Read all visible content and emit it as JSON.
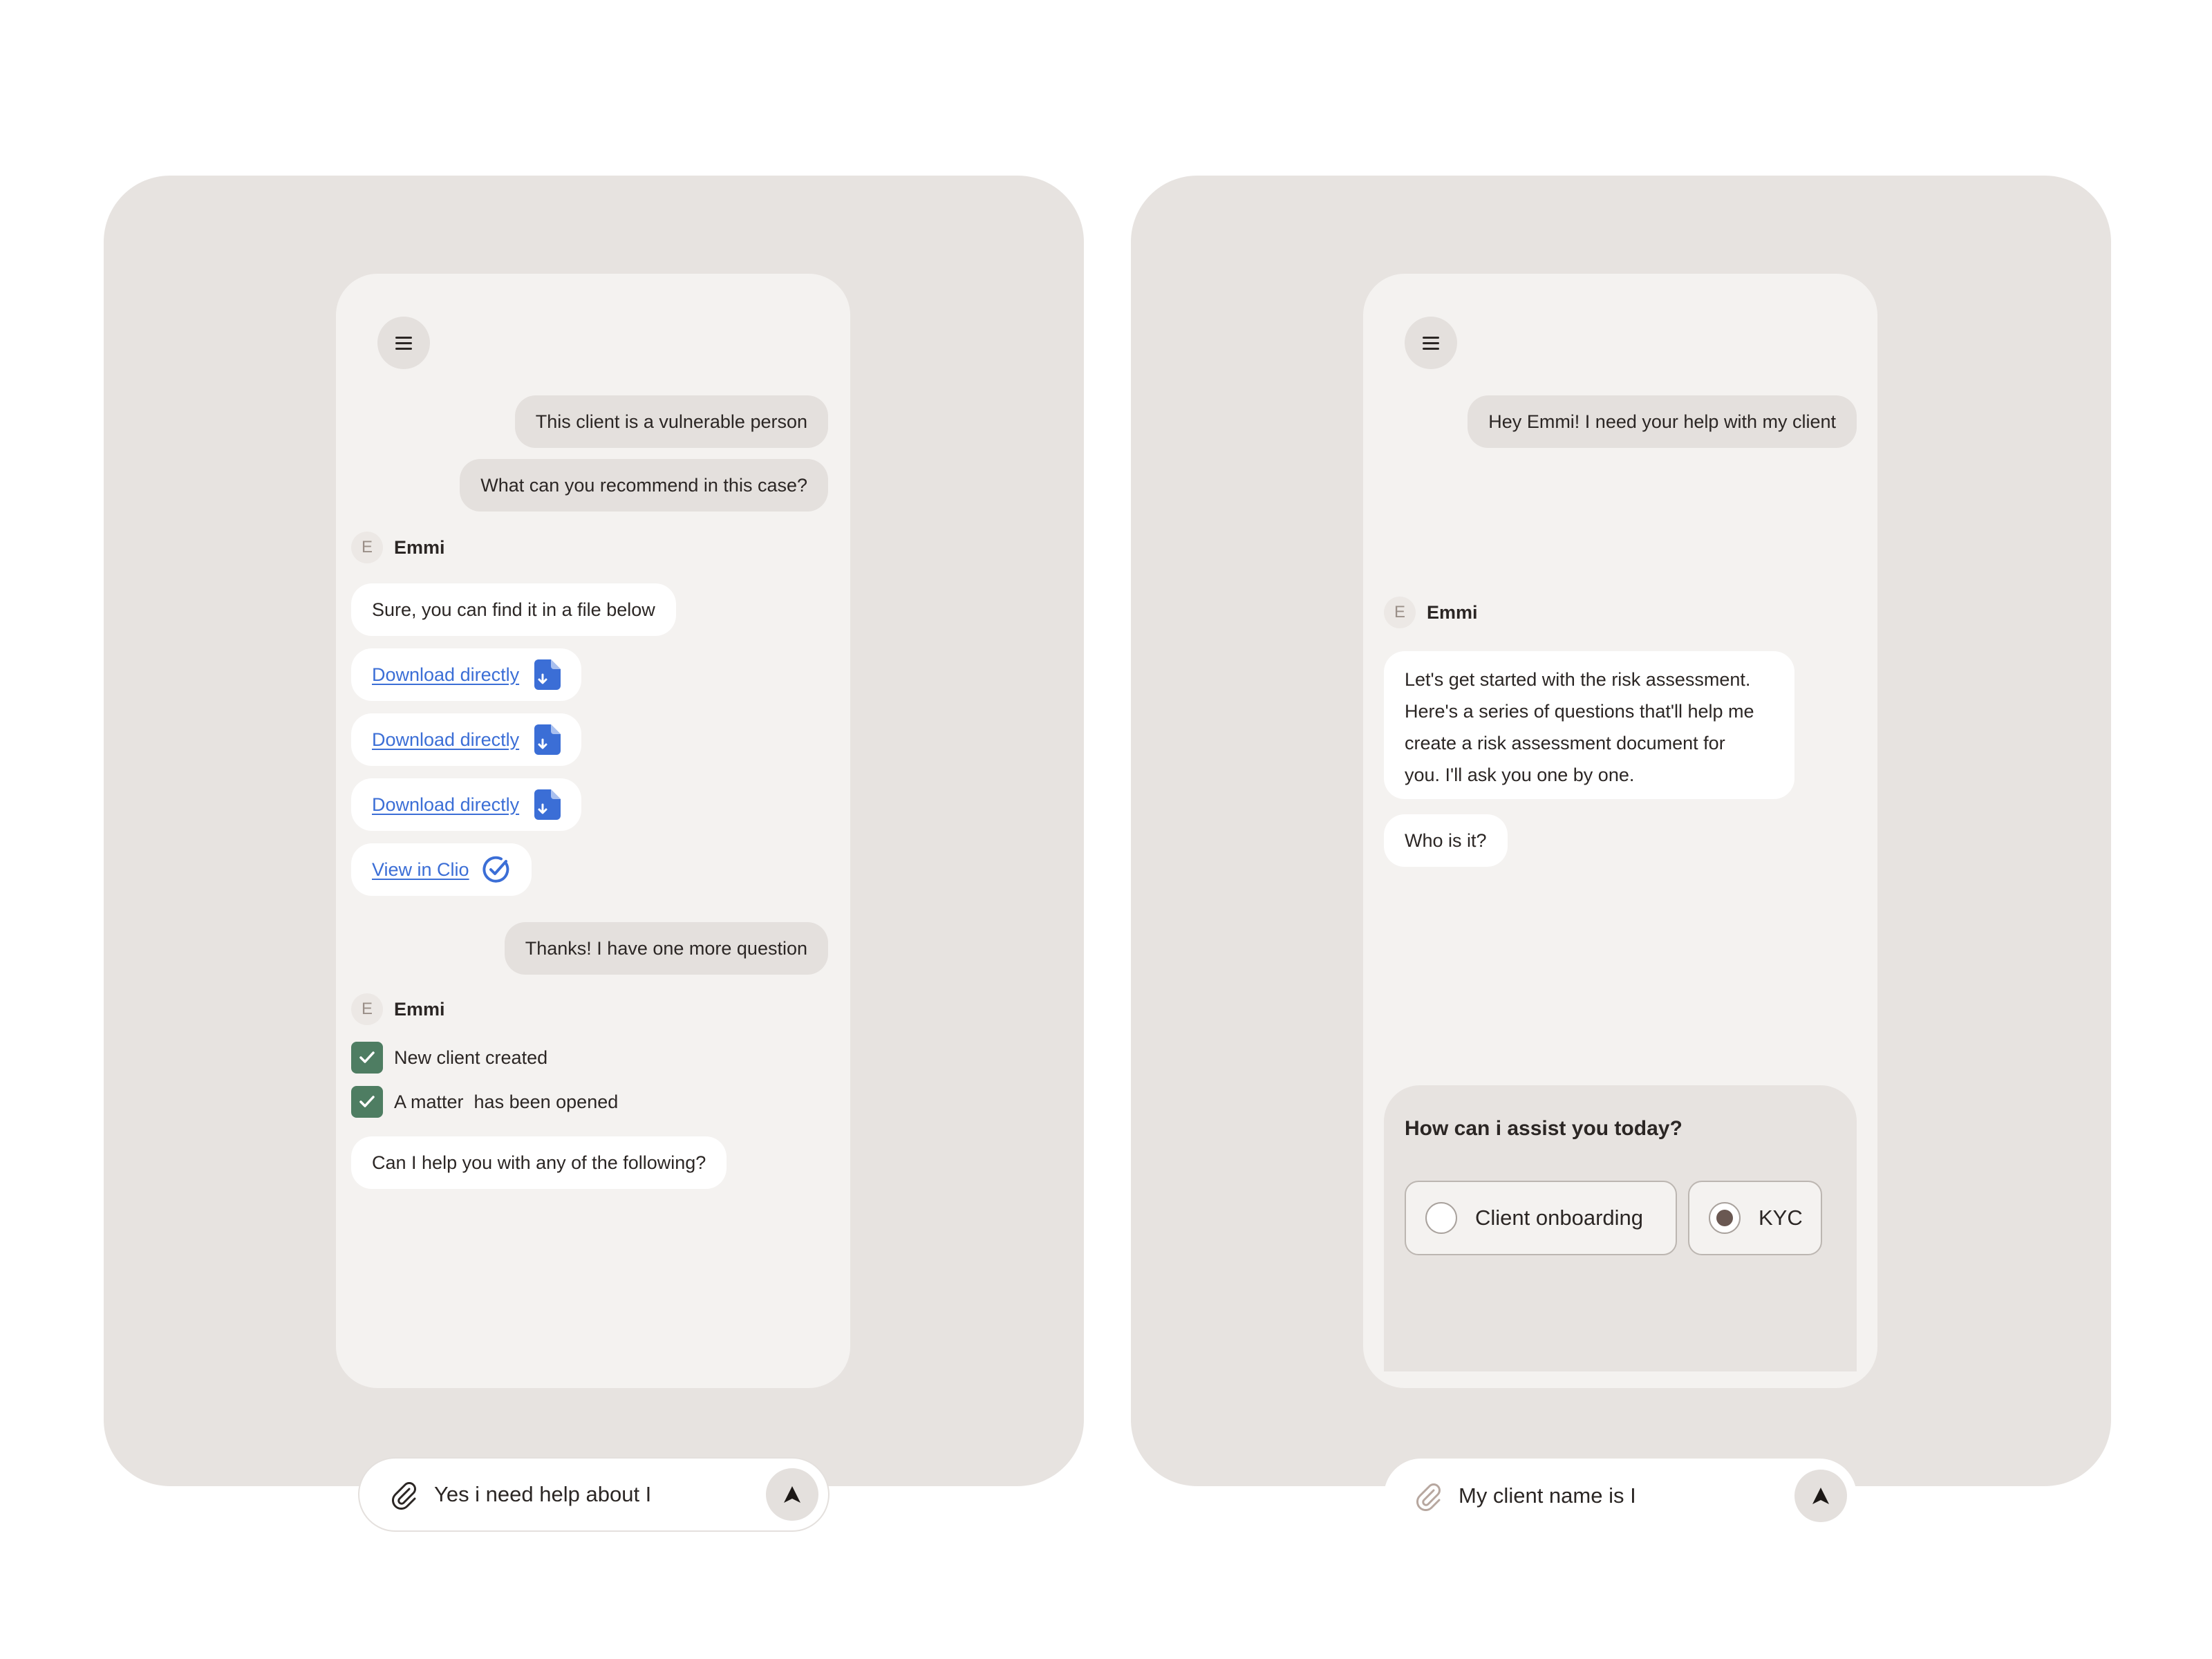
{
  "left_chat": {
    "user_messages": [
      "This client is a vulnerable person",
      "What can you recommend in this case?",
      "Thanks! I have one more question"
    ],
    "sender_name": "Emmi",
    "sender_initial": "E",
    "bot_reply": "Sure, you can find it in a file below",
    "downloads": [
      "Download directly",
      "Download directly",
      "Download directly"
    ],
    "view_link": "View in Clio",
    "checklist": [
      "New client created",
      "A matter  has been opened"
    ],
    "followup": "Can I help you with any of the following?",
    "input_value": "Yes i need help about I"
  },
  "right_chat": {
    "user_message": "Hey Emmi! I need your help with my client",
    "sender_name": "Emmi",
    "sender_initial": "E",
    "bot_lines": [
      "Let's get started with the risk assessment.",
      "Here's a series of questions that'll help me",
      "create a risk assessment document for",
      "you. I'll ask you one by one."
    ],
    "bot_question": "Who is it?",
    "card_title": "How can i assist you today?",
    "options": [
      {
        "label": "Client onboarding",
        "selected": false
      },
      {
        "label": "KYC",
        "selected": true
      }
    ],
    "input_value": "My client name is I"
  },
  "icons": [
    "menu-icon",
    "avatar",
    "file-download-icon",
    "check-circle-icon",
    "checkbox-check-icon",
    "paperclip-icon",
    "send-arrow-icon"
  ],
  "colors": {
    "panel_bg": "#e7e3e0",
    "phone_bg": "#f4f2f0",
    "user_bubble": "#e4e0dd",
    "bot_bubble": "#ffffff",
    "link_blue": "#3b6ed6",
    "check_green": "#4e7d62"
  }
}
